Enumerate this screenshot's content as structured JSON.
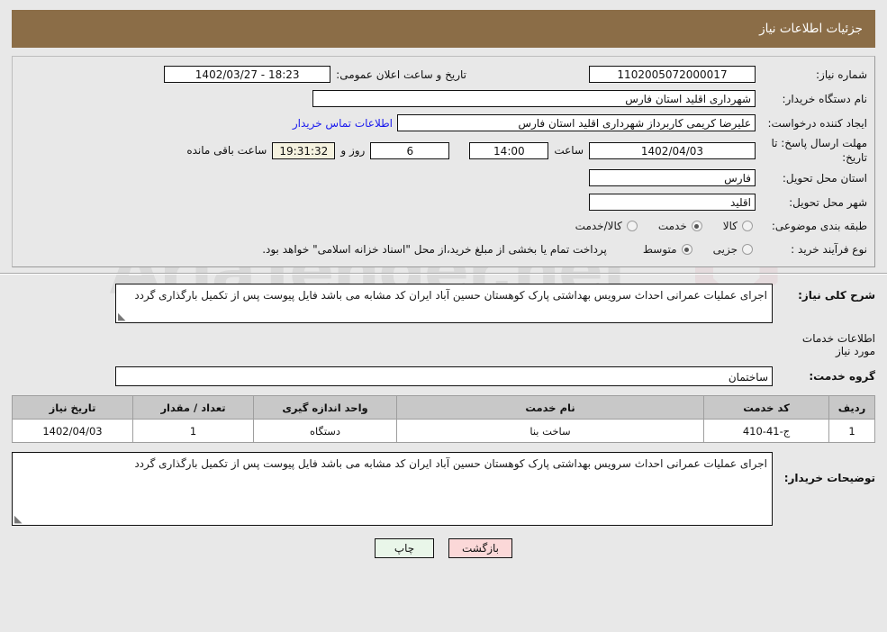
{
  "header": {
    "title": "جزئیات اطلاعات نیاز"
  },
  "fields": {
    "need_number_label": "شماره نیاز:",
    "need_number_value": "1102005072000017",
    "announce_label": "تاریخ و ساعت اعلان عمومی:",
    "announce_value": "18:23 - 1402/03/27",
    "buyer_org_label": "نام دستگاه خریدار:",
    "buyer_org_value": "شهرداری اقلید استان فارس",
    "creator_label": "ایجاد کننده درخواست:",
    "creator_value": "علیرضا کریمی  کاربرداز شهرداری اقلید استان فارس",
    "contact_link": "اطلاعات تماس خریدار",
    "deadline_label": "مهلت ارسال پاسخ: تا تاریخ:",
    "deadline_date": "1402/04/03",
    "hour_label": "ساعت",
    "hour_value": "14:00",
    "days_value": "6",
    "days_label": "روز و",
    "countdown_value": "19:31:32",
    "countdown_label": "ساعت باقی مانده",
    "province_label": "استان محل تحویل:",
    "province_value": "فارس",
    "city_label": "شهر محل تحویل:",
    "city_value": "اقلید",
    "category_label": "طبقه بندی موضوعی:",
    "category_options": [
      {
        "label": "کالا",
        "selected": false
      },
      {
        "label": "خدمت",
        "selected": true
      },
      {
        "label": "کالا/خدمت",
        "selected": false
      }
    ],
    "process_label": "نوع فرآیند خرید :",
    "process_options": [
      {
        "label": "جزیی",
        "selected": false
      },
      {
        "label": "متوسط",
        "selected": true
      }
    ],
    "process_note": "پرداخت تمام یا بخشی از مبلغ خرید،از محل \"اسناد خزانه اسلامی\" خواهد بود."
  },
  "description": {
    "label": "شرح کلی نیاز:",
    "value": "اجرای عملیات عمرانی احداث سرویس بهداشتی پارک کوهستان حسین آباد ایران کد مشابه می باشد فایل پیوست پس از تکمیل بارگذاری گردد"
  },
  "services_section": {
    "title": "اطلاعات خدمات مورد نیاز",
    "group_label": "گروه خدمت:",
    "group_value": "ساختمان"
  },
  "table": {
    "columns": [
      "ردیف",
      "کد خدمت",
      "نام خدمت",
      "واحد اندازه گیری",
      "تعداد / مقدار",
      "تاریخ نیاز"
    ],
    "rows": [
      [
        "1",
        "ج-41-410",
        "ساخت بنا",
        "دستگاه",
        "1",
        "1402/04/03"
      ]
    ]
  },
  "buyer_notes": {
    "label": "توضیحات خریدار:",
    "value": "اجرای عملیات عمرانی احداث سرویس بهداشتی پارک کوهستان حسین آباد ایران کد مشابه می باشد فایل پیوست پس از تکمیل بارگذاری گردد"
  },
  "buttons": {
    "print": "چاپ",
    "back": "بازگشت"
  },
  "watermark": {
    "text": "AriaTender.net"
  },
  "colors": {
    "header_bar": "#8b6d47",
    "page_bg": "#e8e8e8",
    "link": "#1a1aee",
    "print_btn": "#e9f6e9",
    "back_btn": "#fbd8d8",
    "countdown_bg": "#f5f2df",
    "table_header": "#c8c8c8"
  }
}
